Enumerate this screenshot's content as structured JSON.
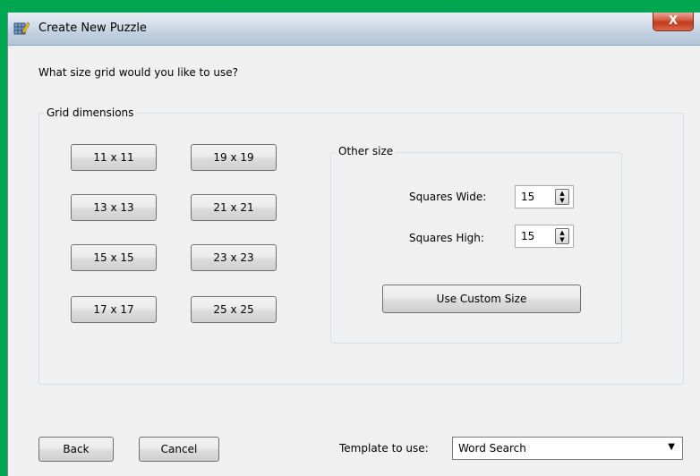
{
  "window": {
    "title": "Create New Puzzle",
    "close_label": "X"
  },
  "prompt": "What size grid would you like to  use?",
  "grid_dimensions": {
    "label": "Grid dimensions",
    "buttons": [
      "11 x 11",
      "19 x 19",
      "13 x 13",
      "21 x 21",
      "15 x 15",
      "23 x 23",
      "17 x 17",
      "25 x 25"
    ]
  },
  "other_size": {
    "label": "Other size",
    "squares_wide_label": "Squares Wide:",
    "squares_wide_value": "15",
    "squares_high_label": "Squares High:",
    "squares_high_value": "15",
    "custom_button": "Use Custom Size"
  },
  "footer": {
    "back_label": "Back",
    "cancel_label": "Cancel",
    "template_label": "Template to use:",
    "template_value": "Word Search"
  },
  "icons": {
    "app": "puzzle-pencil-icon",
    "spin_up": "▲",
    "spin_down": "▼",
    "dropdown": "▼"
  }
}
